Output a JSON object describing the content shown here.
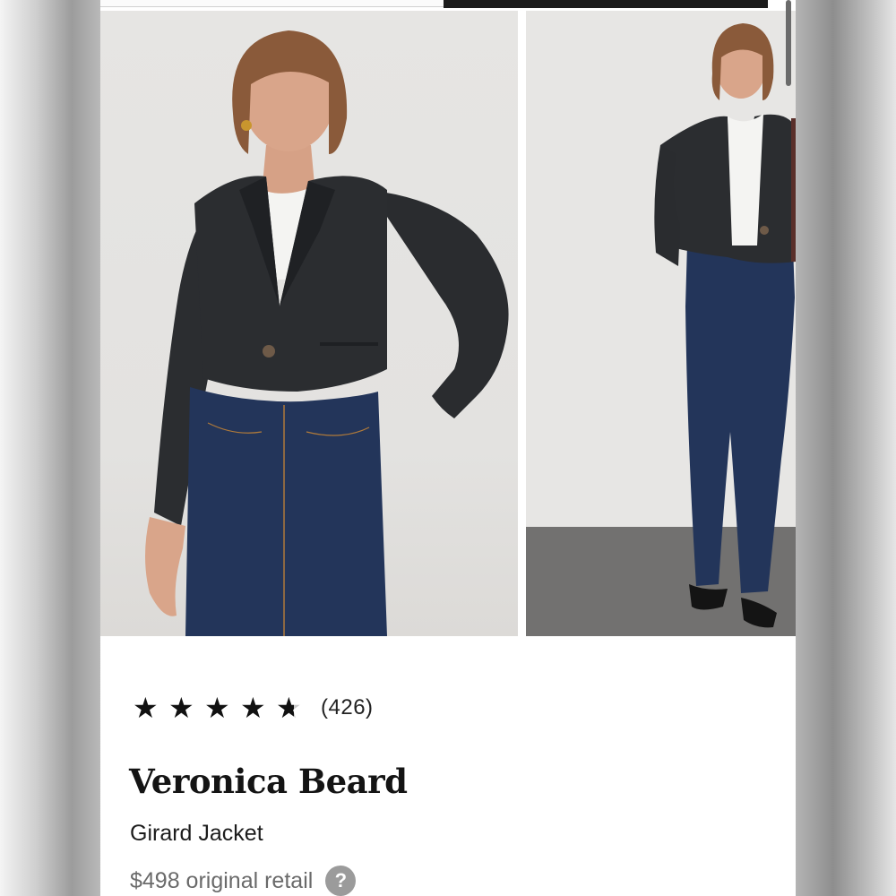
{
  "product": {
    "rating": {
      "value": 4.5,
      "max": 5,
      "review_count_label": "(426)"
    },
    "brand": "Veronica Beard",
    "name": "Girard Jacket",
    "retail_price_label": "$498 original retail"
  },
  "icons": {
    "star": "star-icon",
    "help": "question-circle-icon",
    "help_glyph": "?"
  },
  "gallery": {
    "images": [
      {
        "name": "model-front-crop",
        "desc_icon": "product-photo"
      },
      {
        "name": "model-full-length",
        "desc_icon": "product-photo"
      }
    ]
  },
  "colors": {
    "jacket": "#2b2d30",
    "denim": "#23355a",
    "tee": "#f4f4f2",
    "hair": "#8a5a3a",
    "skin": "#d9a58a",
    "backdrop": "#e6e5e3",
    "floor": "#727170"
  }
}
